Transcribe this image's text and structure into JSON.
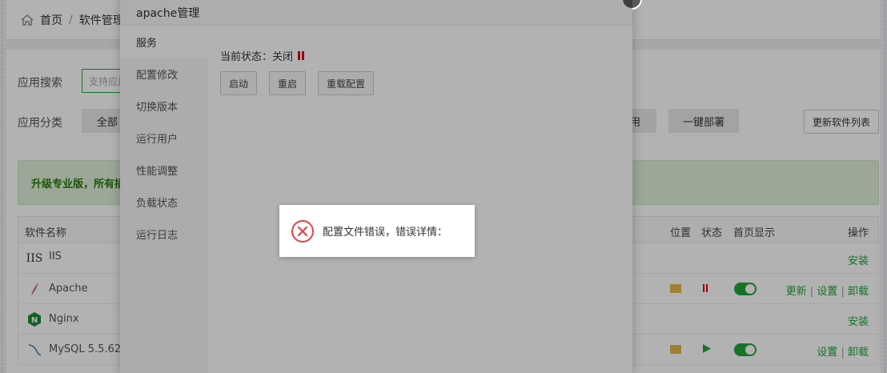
{
  "breadcrumb": {
    "home": "首页",
    "separator": "/",
    "current": "软件管理"
  },
  "search": {
    "label": "应用搜索",
    "placeholder": "支持应用"
  },
  "category": {
    "label": "应用分类",
    "all": "全部",
    "partial": "用",
    "deploy": "一键部署"
  },
  "update_button": "更新软件列表",
  "promo": "升级专业版，所有插件",
  "table": {
    "headers": {
      "name": "软件名称",
      "location": "位置",
      "status": "状态",
      "home_display": "首页显示",
      "actions": "操作"
    },
    "rows": [
      {
        "icon": "iis-icon",
        "icon_text": "IIS",
        "name": "IIS",
        "ops": [
          "安装"
        ]
      },
      {
        "icon": "apache-feather-icon",
        "name": "Apache",
        "ops": [
          "更新",
          "设置",
          "卸载"
        ],
        "status": "stopped",
        "home": true
      },
      {
        "icon": "nginx-icon",
        "icon_text": "N",
        "name": "Nginx",
        "ops": [
          "安装"
        ]
      },
      {
        "icon": "mysql-dolphin-icon",
        "name": "MySQL 5.5.62",
        "ops": [
          "设置",
          "卸载"
        ],
        "status": "running",
        "home": true
      }
    ],
    "op_separator": "|"
  },
  "modal": {
    "title": "apache管理",
    "menu": [
      "服务",
      "配置修改",
      "切换版本",
      "运行用户",
      "性能调整",
      "负载状态",
      "运行日志"
    ],
    "status_text": "当前状态：关闭",
    "buttons": {
      "start": "启动",
      "restart": "重启",
      "reload": "重载配置"
    }
  },
  "toast": {
    "message": "配置文件错误，错误详情："
  },
  "colors": {
    "accent": "#20a53a",
    "stopped": "#e20000",
    "error": "#e0424a"
  }
}
